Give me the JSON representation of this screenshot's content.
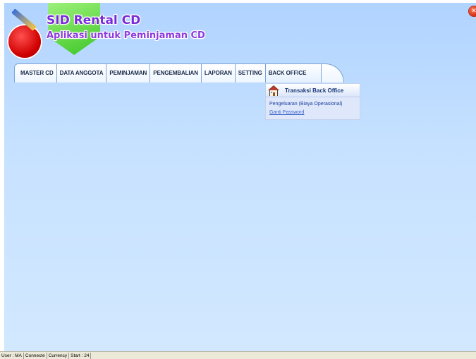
{
  "app": {
    "title": "SID Rental CD",
    "subtitle": "Aplikasi untuk Peminjaman CD",
    "close_icon": "close-icon"
  },
  "menu": {
    "items": [
      {
        "label": "MASTER CD"
      },
      {
        "label": "DATA ANGGOTA"
      },
      {
        "label": "PEMINJAMAN"
      },
      {
        "label": "PENGEMBALIAN"
      },
      {
        "label": "LAPORAN"
      },
      {
        "label": "SETTING"
      },
      {
        "label": "BACK OFFICE"
      }
    ],
    "active": "BACK OFFICE"
  },
  "dropdown": {
    "icon": "house-icon",
    "title": "Transaksi Back Office",
    "links": [
      {
        "label": "Pengeluaran (Biaya Operasional)"
      },
      {
        "label": "Ganti Password"
      }
    ]
  },
  "statusbar": {
    "cells": [
      "User : MA",
      "Connecte",
      "Currency",
      "Start : 24"
    ]
  },
  "colors": {
    "background": "#c6e1ff",
    "logo_text": "#7a2ad8",
    "logo_green": "#3ec628",
    "logo_red": "#d00000"
  }
}
